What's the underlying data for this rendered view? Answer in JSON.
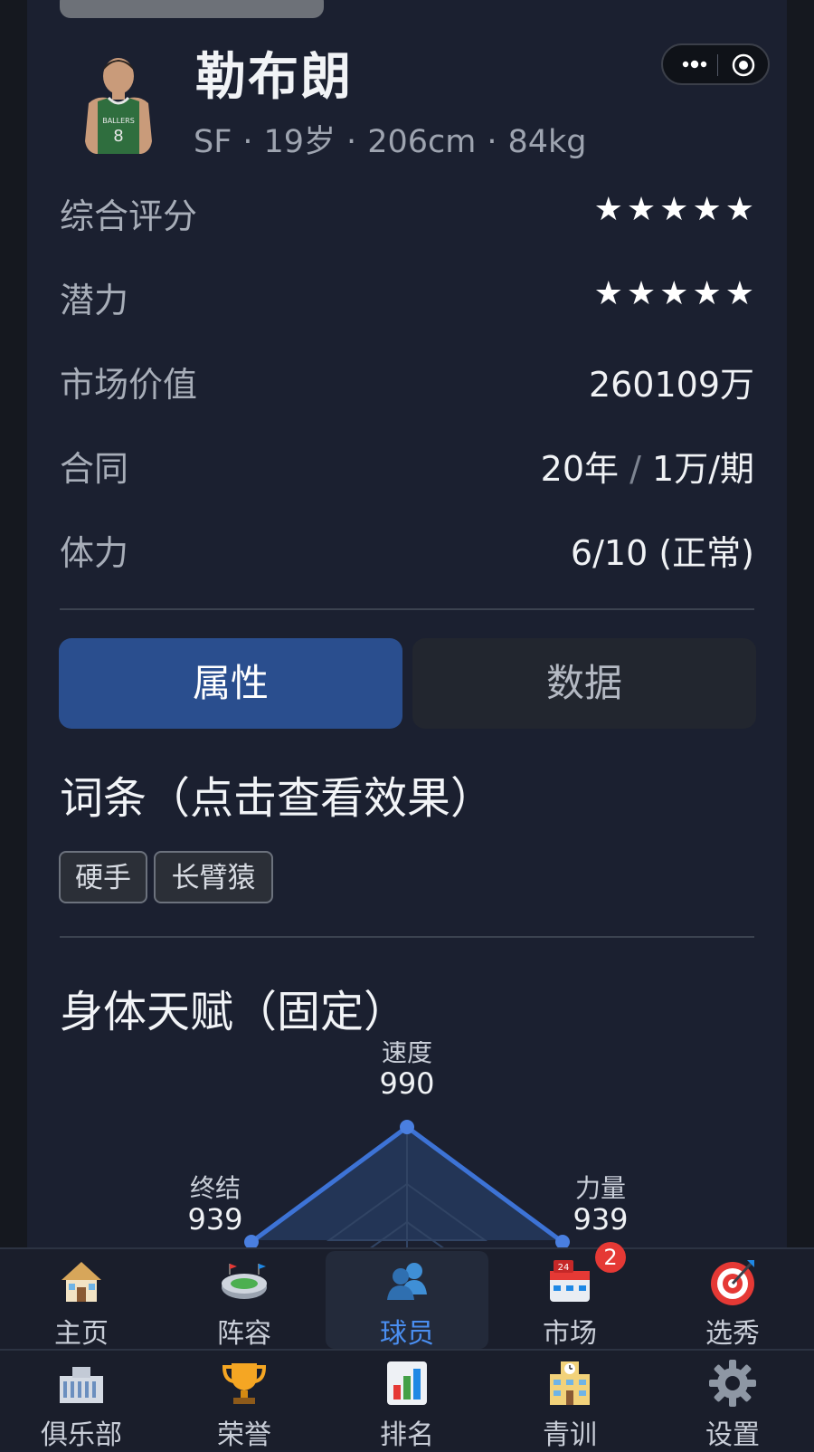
{
  "player": {
    "name": "勒布朗",
    "position": "SF",
    "age": "19岁",
    "height": "206cm",
    "weight": "84kg",
    "jersey_text": "BALLERS",
    "jersey_number": "8"
  },
  "info": {
    "overall_label": "综合评分",
    "overall_stars": 5,
    "potential_label": "潜力",
    "potential_stars": 5,
    "market_label": "市场价值",
    "market_value": "260109万",
    "contract_label": "合同",
    "contract_years": "20年",
    "contract_pay": "1万/期",
    "stamina_label": "体力",
    "stamina_value": "6/10 (正常)"
  },
  "tabs": {
    "attributes": "属性",
    "data": "数据"
  },
  "traits": {
    "title": "词条（点击查看效果）",
    "items": [
      "硬手",
      "长臂猿"
    ]
  },
  "physical": {
    "title": "身体天赋（固定）",
    "speed_label": "速度",
    "speed_value": "990",
    "finish_label": "终结",
    "finish_value": "939",
    "strength_label": "力量",
    "strength_value": "939"
  },
  "nav": {
    "row1": [
      {
        "label": "主页",
        "icon": "house-icon"
      },
      {
        "label": "阵容",
        "icon": "stadium-icon"
      },
      {
        "label": "球员",
        "icon": "players-icon",
        "active": true
      },
      {
        "label": "市场",
        "icon": "market-icon",
        "badge": "2"
      },
      {
        "label": "选秀",
        "icon": "target-icon"
      }
    ],
    "row2": [
      {
        "label": "俱乐部",
        "icon": "club-building-icon"
      },
      {
        "label": "荣誉",
        "icon": "trophy-icon"
      },
      {
        "label": "排名",
        "icon": "bar-chart-icon"
      },
      {
        "label": "青训",
        "icon": "school-icon"
      },
      {
        "label": "设置",
        "icon": "gear-icon"
      }
    ]
  },
  "colors": {
    "accent": "#4a8ef0",
    "active_tab": "#2a4e8e",
    "radar_line": "#3d73d6",
    "badge": "#e53935"
  }
}
